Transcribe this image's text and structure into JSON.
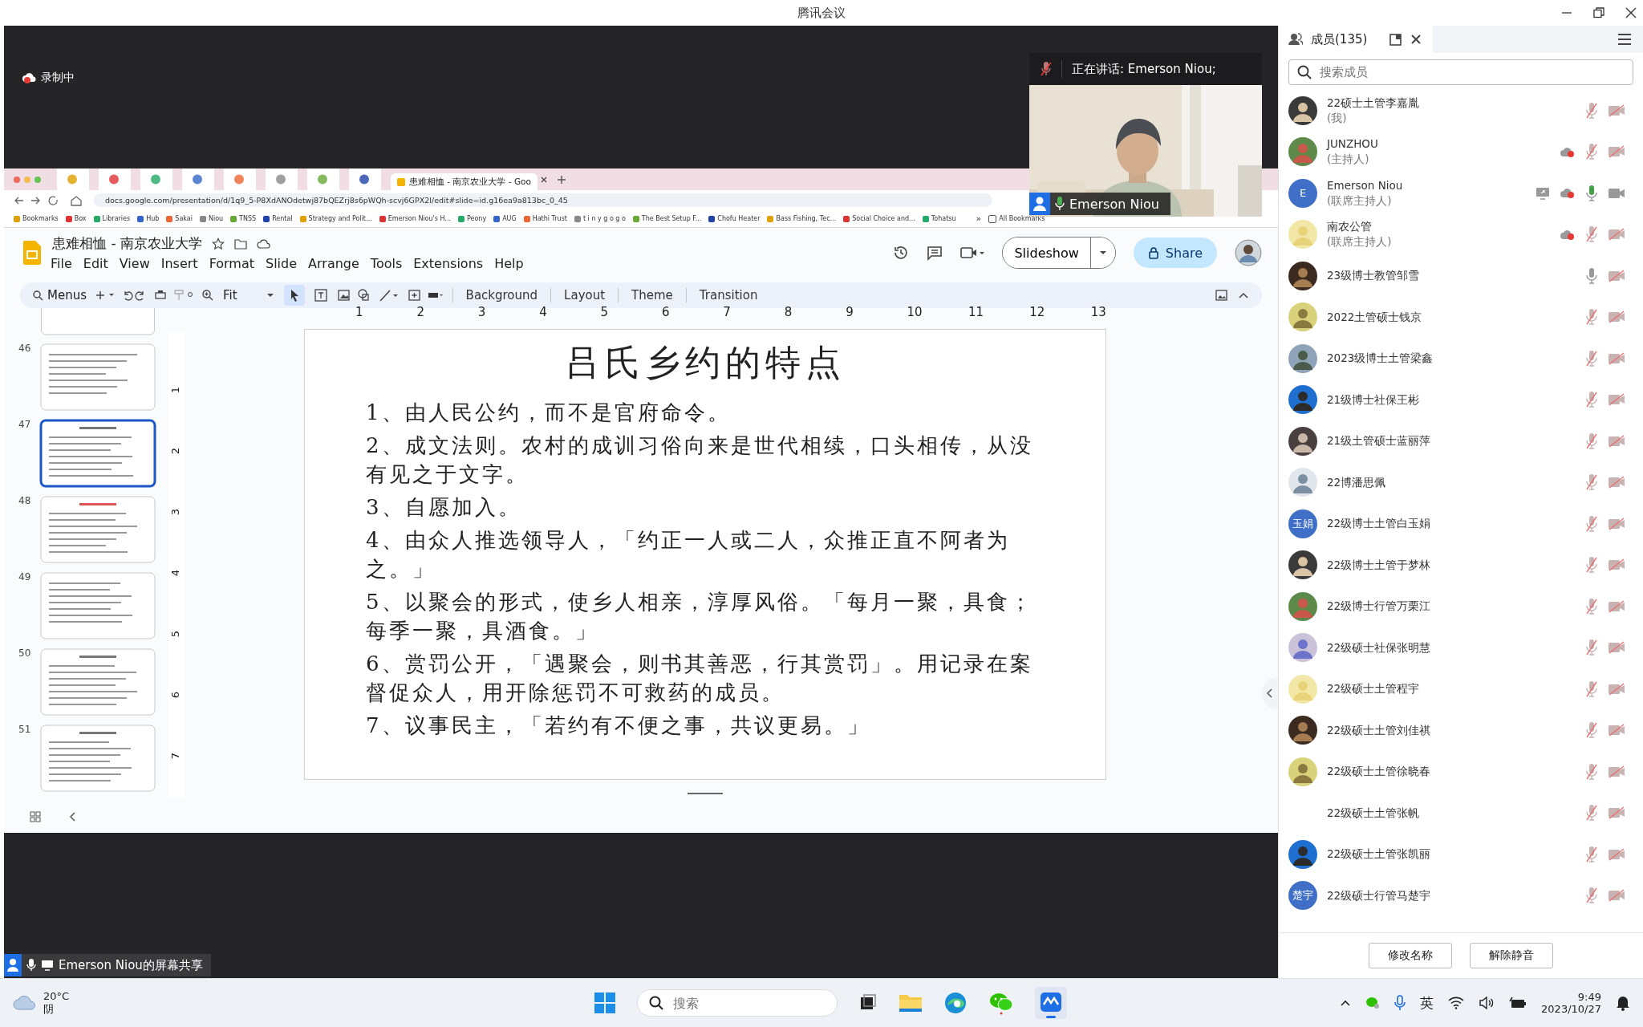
{
  "window": {
    "title": "腾讯会议"
  },
  "recording": {
    "label": "录制中"
  },
  "speaker": {
    "label": "正在讲话:  Emerson Niou;",
    "name": "Emerson Niou",
    "kind": "picture"
  },
  "browser": {
    "tab": {
      "label": "患难相恤 - 南京农业大学 - Goo",
      "selected": true
    },
    "address": "docs.google.com/presentation/d/1q9_5-P8XdANOdetwj87bQEZrj8s6pWQh-scvj6GPX2I/edit#slide=id.g16ea9a813bc_0_45",
    "bookmarks": [
      {
        "label": "Bookmarks"
      },
      {
        "label": "Box"
      },
      {
        "label": "Libraries"
      },
      {
        "label": "Hub"
      },
      {
        "label": "Sakai"
      },
      {
        "label": "Niou"
      },
      {
        "label": "TNSS"
      },
      {
        "label": "Rental"
      },
      {
        "label": "Strategy and Polit..."
      },
      {
        "label": "Emerson Niou's H..."
      },
      {
        "label": "Peony"
      },
      {
        "label": "AUG"
      },
      {
        "label": "Hathi Trust"
      },
      {
        "label": "t i n y g o g o"
      },
      {
        "label": "The Best Setup F..."
      },
      {
        "label": "Chofu Heater"
      },
      {
        "label": "Bass Fishing, Tec..."
      },
      {
        "label": "Social Choice and..."
      },
      {
        "label": "Tohatsu"
      }
    ],
    "more": "»",
    "all_bookmarks": "All Bookmarks"
  },
  "docs": {
    "title": "患难相恤 - 南京农业大学",
    "menu": [
      "File",
      "Edit",
      "View",
      "Insert",
      "Format",
      "Slide",
      "Arrange",
      "Tools",
      "Extensions",
      "Help"
    ],
    "slideshow": "Slideshow",
    "share": "Share",
    "toolbar": {
      "search": "Menus",
      "zoom": "Fit",
      "buttons": [
        "Background",
        "Layout",
        "Theme",
        "Transition"
      ]
    },
    "ruler": [
      "1",
      "2",
      "3",
      "4",
      "5",
      "6",
      "7",
      "8",
      "9",
      "10",
      "11",
      "12",
      "13"
    ],
    "vruler": [
      "1",
      "2",
      "3",
      "4",
      "5",
      "6",
      "7"
    ],
    "thumbnails": [
      {
        "number": "46",
        "selected": false
      },
      {
        "number": "47",
        "selected": true
      },
      {
        "number": "48",
        "selected": false
      },
      {
        "number": "49",
        "selected": false
      },
      {
        "number": "50",
        "selected": false
      },
      {
        "number": "51",
        "selected": false
      }
    ],
    "slide": {
      "title": "吕氏乡约的特点",
      "points": [
        "1、由人民公约，而不是官府命令。",
        "2、成文法则。农村的成训习俗向来是世代相续，口头相传，从没有见之于文字。",
        "3、自愿加入。",
        "4、由众人推选领导人，「约正一人或二人，众推正直不阿者为之。」",
        "5、以聚会的形式，使乡人相亲，淳厚风俗。「每月一聚，具食；每季一聚，具酒食。」",
        "6、赏罚公开，「遇聚会，则书其善恶，行其赏罚」。用记录在案督促众人，用开除惩罚不可救药的成员。",
        "7、议事民主，「若约有不便之事，共议更易。」"
      ]
    }
  },
  "share_label": "Emerson Niou的屏幕共享",
  "members": {
    "title": "成员(135)",
    "search_placeholder": "搜索成员",
    "items": [
      {
        "name": "22硕士土管李嘉胤",
        "role": "(我)",
        "recording": false,
        "sharing": false,
        "mic_on": false,
        "speaking": false,
        "camera_on": false
      },
      {
        "name": "JUNZHOU",
        "role": "(主持人)",
        "recording": true,
        "sharing": false,
        "mic_on": false,
        "speaking": false,
        "camera_on": false
      },
      {
        "name": "Emerson Niou",
        "role": "(联席主持人)",
        "avatar": {
          "kind": "initials",
          "text": "E"
        },
        "recording": true,
        "sharing": true,
        "mic_on": true,
        "speaking": true,
        "camera_on": true
      },
      {
        "name": "南农公管",
        "role": "(联席主持人)",
        "recording": true,
        "sharing": false,
        "mic_on": false,
        "speaking": false,
        "camera_on": false
      },
      {
        "name": "23级博士教管邹雪",
        "recording": false,
        "sharing": false,
        "mic_on": true,
        "speaking": false,
        "camera_on": false
      },
      {
        "name": "2022土管硕士钱京",
        "recording": false,
        "sharing": false,
        "mic_on": false,
        "speaking": false,
        "camera_on": false
      },
      {
        "name": "2023级博士土管梁鑫",
        "recording": false,
        "sharing": false,
        "mic_on": false,
        "speaking": false,
        "camera_on": false
      },
      {
        "name": "21级博士社保王彬",
        "recording": false,
        "sharing": false,
        "mic_on": false,
        "speaking": false,
        "camera_on": false
      },
      {
        "name": "21级土管硕士蓝丽萍",
        "recording": false,
        "sharing": false,
        "mic_on": false,
        "speaking": false,
        "camera_on": false
      },
      {
        "name": "22博潘思佩",
        "recording": false,
        "sharing": false,
        "mic_on": false,
        "speaking": false,
        "camera_on": false
      },
      {
        "name": "22级博士土管白玉娟",
        "avatar": {
          "kind": "initials",
          "text": "玉娟"
        },
        "recording": false,
        "sharing": false,
        "mic_on": false,
        "speaking": false,
        "camera_on": false
      },
      {
        "name": "22级博士土管于梦林",
        "recording": false,
        "sharing": false,
        "mic_on": false,
        "speaking": false,
        "camera_on": false
      },
      {
        "name": "22级博士行管万栗江",
        "recording": false,
        "sharing": false,
        "mic_on": false,
        "speaking": false,
        "camera_on": false
      },
      {
        "name": "22级硕士社保张明慧",
        "recording": false,
        "sharing": false,
        "mic_on": false,
        "speaking": false,
        "camera_on": false
      },
      {
        "name": "22级硕士土管程宇",
        "recording": false,
        "sharing": false,
        "mic_on": false,
        "speaking": false,
        "camera_on": false
      },
      {
        "name": "22级硕士土管刘佳祺",
        "recording": false,
        "sharing": false,
        "mic_on": false,
        "speaking": false,
        "camera_on": false
      },
      {
        "name": "22级硕士土管徐晓春",
        "recording": false,
        "sharing": false,
        "mic_on": false,
        "speaking": false,
        "camera_on": false
      },
      {
        "name": "22级硕士土管张帆",
        "recording": false,
        "sharing": false,
        "mic_on": false,
        "speaking": false,
        "camera_on": false
      },
      {
        "name": "22级硕士土管张凯丽",
        "recording": false,
        "sharing": false,
        "mic_on": false,
        "speaking": false,
        "camera_on": false
      },
      {
        "name": "22级硕士行管马楚宇",
        "avatar": {
          "kind": "initials",
          "text": "楚宇"
        },
        "recording": false,
        "sharing": false,
        "mic_on": false,
        "speaking": false,
        "camera_on": false
      }
    ],
    "buttons": [
      "修改名称",
      "解除静音"
    ]
  },
  "taskbar": {
    "temperature": "20°C",
    "weather": "阴",
    "search_placeholder": "搜索",
    "ime": "英",
    "time": "9:49",
    "date": "2023/10/27"
  }
}
